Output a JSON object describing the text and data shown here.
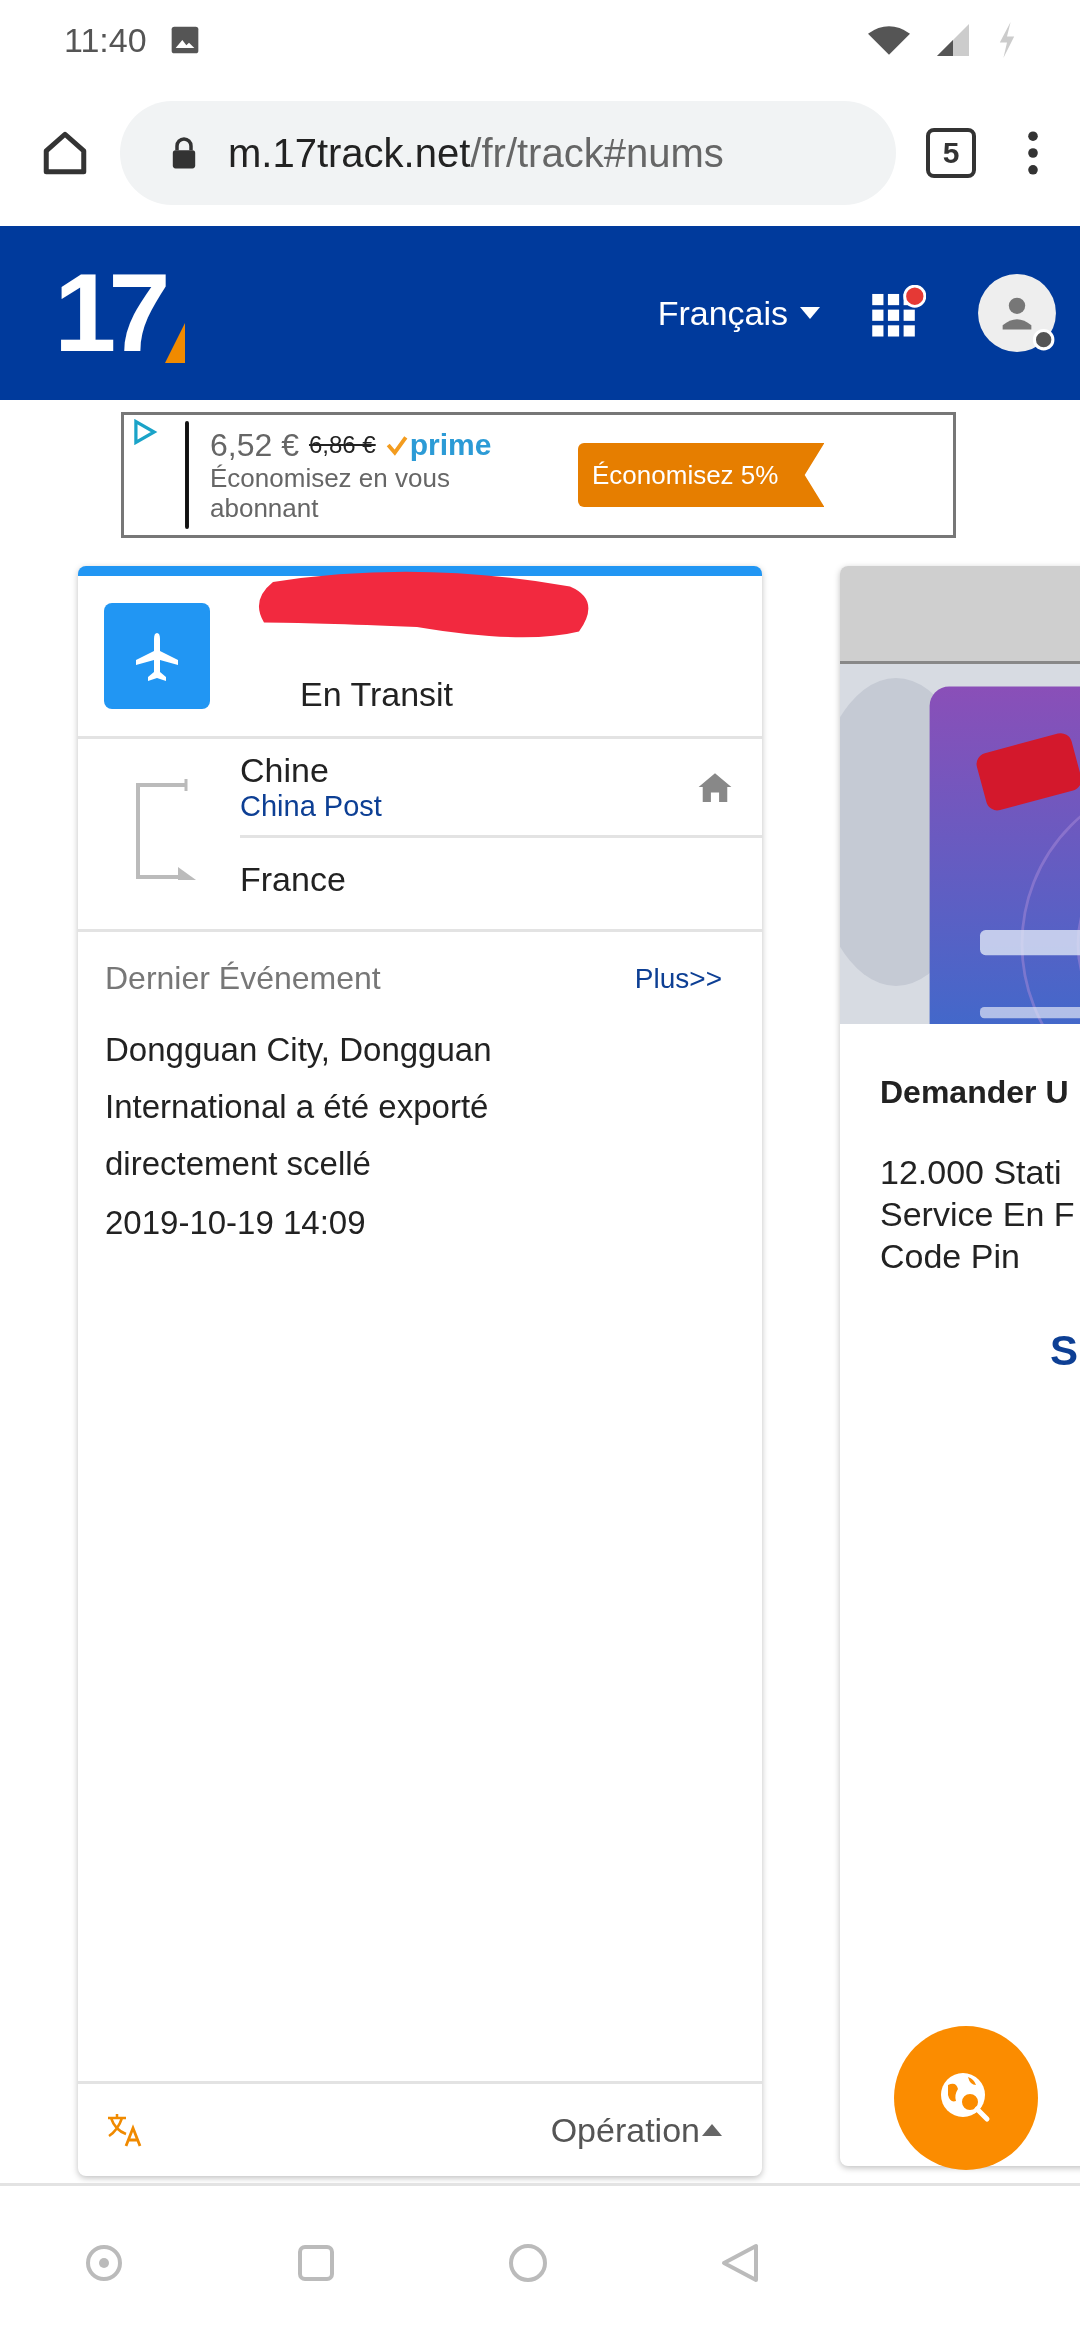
{
  "status_bar": {
    "time": "11:40"
  },
  "browser": {
    "url_host": "m.17track.net",
    "url_path": "/fr/track#nums",
    "tab_count": "5"
  },
  "header": {
    "logo": "17",
    "language": "Français",
    "notification": true
  },
  "ad": {
    "price": "6,52 €",
    "old_price": "6,86 €",
    "badge": "prime",
    "description": "Économisez en vous abonnant",
    "cta": "Économisez 5%"
  },
  "tracking_card": {
    "status": "En Transit",
    "origin": "Chine",
    "carrier": "China Post",
    "destination": "France",
    "section_title": "Dernier Événement",
    "more_link": "Plus>>",
    "event": "Dongguan City, Dongguan International a été exporté directement scellé",
    "event_time": "2019-10-19 14:09",
    "operation": "Opération"
  },
  "promo_card": {
    "title": "Demander U",
    "lines": [
      "12.000 Stati",
      "Service En F",
      "Code Pin"
    ],
    "link": "S"
  }
}
